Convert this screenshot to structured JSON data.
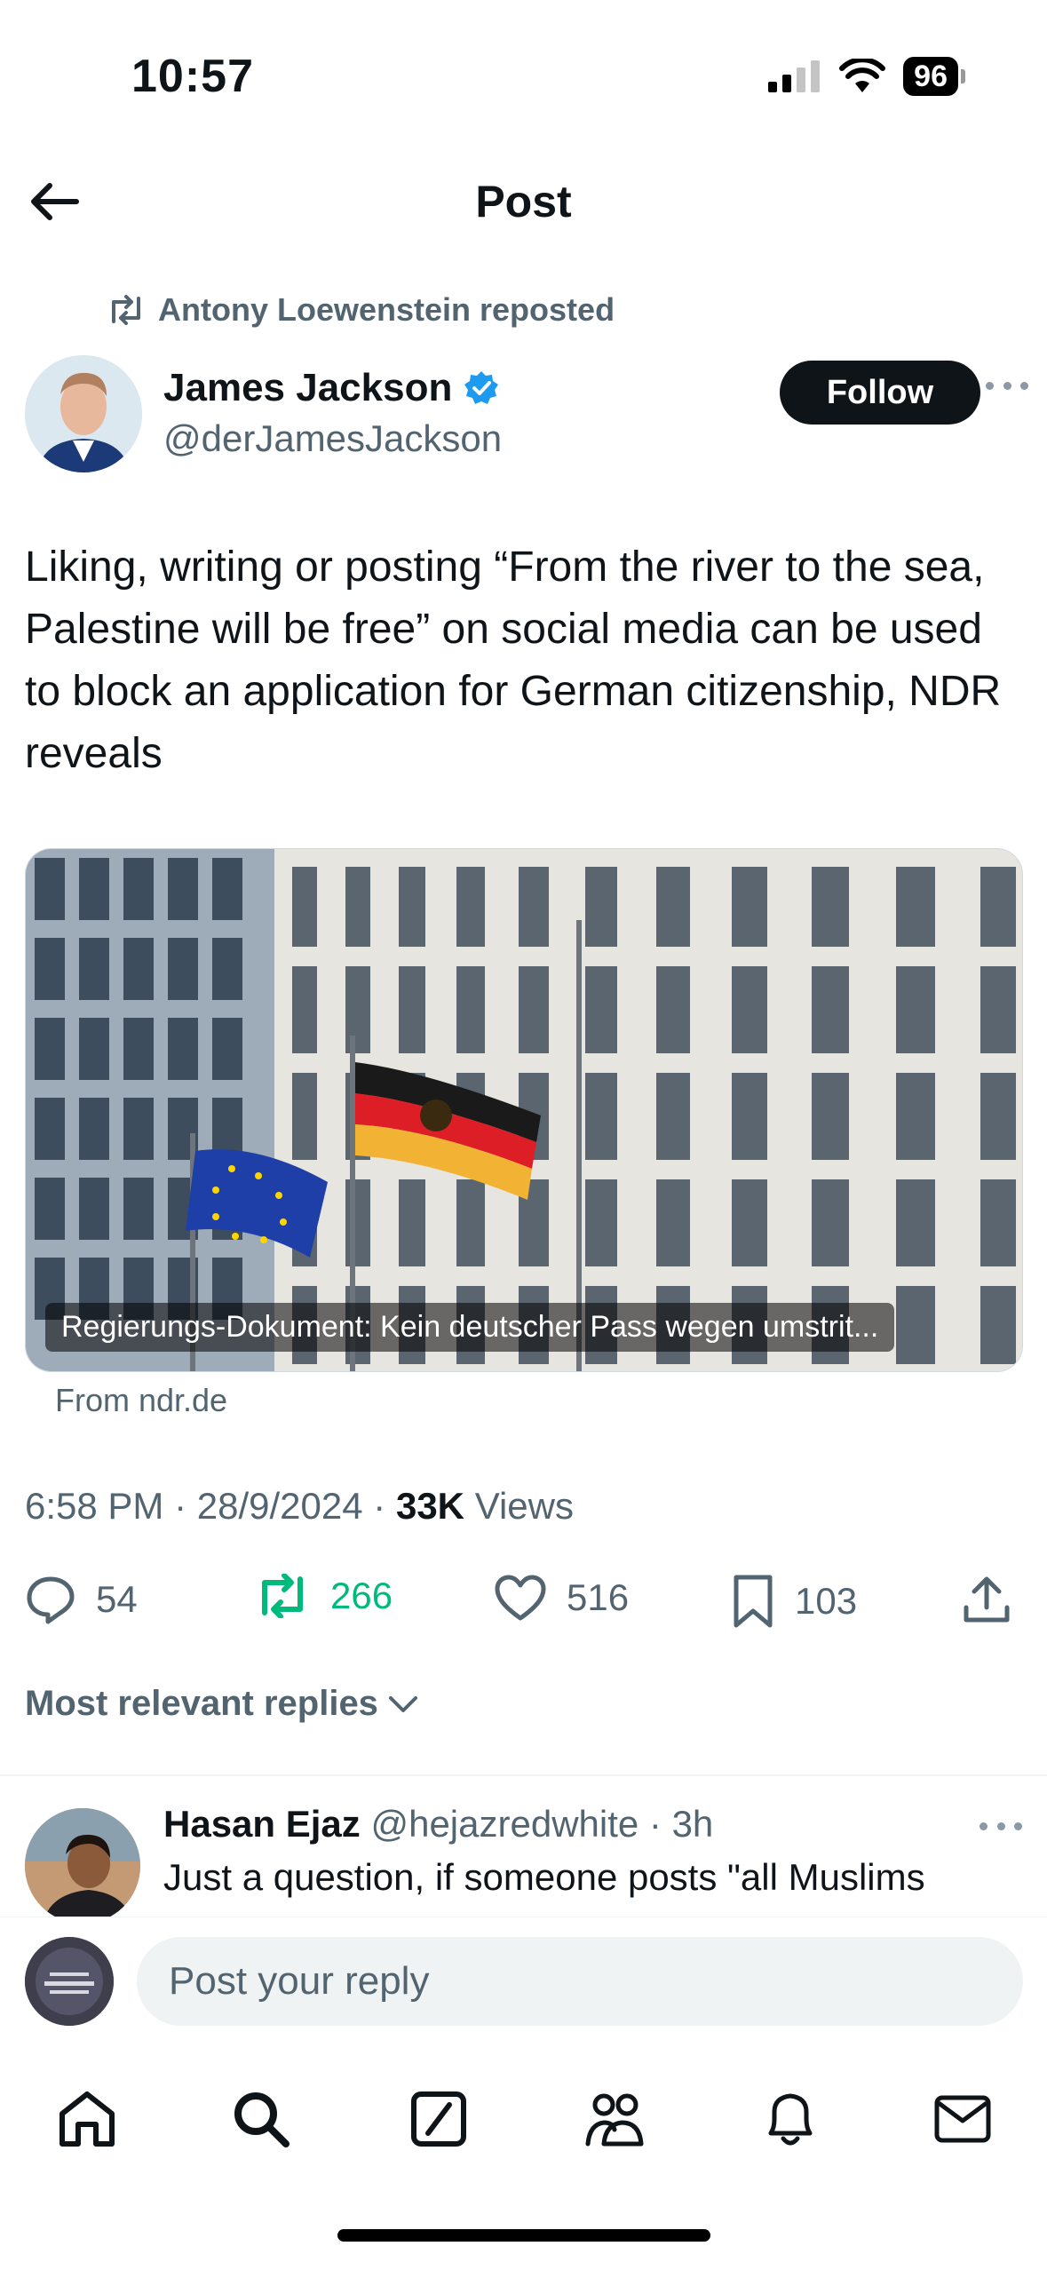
{
  "status_bar": {
    "time": "10:57",
    "battery": "96"
  },
  "header": {
    "title": "Post"
  },
  "repost": {
    "text": "Antony Loewenstein reposted"
  },
  "author": {
    "name": "James Jackson",
    "handle": "@derJamesJackson",
    "verified": true,
    "follow_label": "Follow"
  },
  "tweet": {
    "text": "Liking, writing or posting “From the river to the sea, Palestine will be free” on social media can be used to block an application for German citizenship, NDR reveals"
  },
  "card": {
    "caption": "Regierungs-Dokument: Kein deutscher Pass wegen umstrit...",
    "source": "From ndr.de"
  },
  "meta": {
    "time": "6:58 PM",
    "date": "28/9/2024",
    "views_count": "33K",
    "views_label": "Views",
    "sep": "·"
  },
  "actions": {
    "replies": "54",
    "reposts": "266",
    "likes": "516",
    "bookmarks": "103"
  },
  "replies_filter": {
    "label": "Most relevant replies"
  },
  "reply": {
    "name": "Hasan Ejaz",
    "handle": "@hejazredwhite",
    "time": "· 3h",
    "text": "Just a question, if someone posts \"all Muslims"
  },
  "composer": {
    "placeholder": "Post your reply"
  },
  "colors": {
    "green": "#00ba7c",
    "verified": "#1d9bf0",
    "text_secondary": "#536471"
  }
}
